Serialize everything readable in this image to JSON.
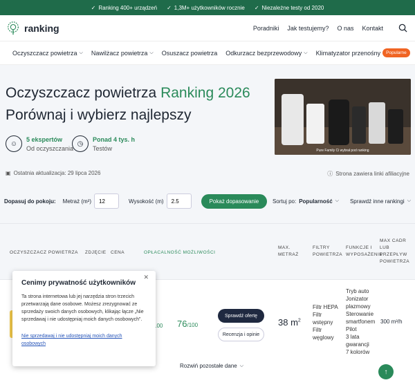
{
  "topbar": [
    "Ranking 400+ urządzeń",
    "1,3M+ użytkowników rocznie",
    "Niezależne testy od 2020"
  ],
  "logo": "ranking",
  "nav": [
    "Poradniki",
    "Jak testujemy?",
    "O nas",
    "Kontakt"
  ],
  "categories": [
    {
      "label": "Oczyszczacz powietrza",
      "chev": true
    },
    {
      "label": "Nawilżacz powietrza",
      "chev": true
    },
    {
      "label": "Osuszacz powietrza",
      "chev": false
    },
    {
      "label": "Odkurzacz bezprzewodowy",
      "chev": true
    },
    {
      "label": "Klimatyzator przenośny",
      "chev": false
    }
  ],
  "popular_badge": "Popularne",
  "hero": {
    "title_a": "Oczyszczacz powietrza",
    "title_b": "Ranking 2026",
    "subtitle": "Porównaj i wybierz najlepszy",
    "image_caption": "Pure Family Ci wybrał pod ranking",
    "expert_1": {
      "strong": "5 ekspertów",
      "sub": "Od oczyszczania"
    },
    "expert_2": {
      "strong": "Ponad 4 tys. h",
      "sub": "Testów"
    },
    "updated": "Ostatnia aktualizacja: 29 lipca 2026",
    "affiliate": "Strona zawiera linki afiliacyjne"
  },
  "fit": {
    "label": "Dopasuj do pokoju:",
    "area_label": "Metraż (m²)",
    "area_value": "12",
    "height_label": "Wysokość (m)",
    "height_value": "2.5",
    "button": "Pokaż dopasowanie",
    "sort_label": "Sortuj po:",
    "sort_value": "Popularność",
    "other": "Sprawdź inne rankingi"
  },
  "table": {
    "headers": {
      "product": "OCZYSZCZACZ POWIETRZA",
      "photo": "ZDJĘCIE",
      "price": "CENA",
      "value": "OPŁACALNOŚĆ MOŻLIWOŚCI",
      "area": "MAX. METRAŻ",
      "filters": "FILTRY POWIETRZA",
      "functions": "FUNKCJE I WYPOSAŻENIE",
      "cadr": "MAX CADR LUB PRZEPŁYW POWIETRZA"
    },
    "row": {
      "score_1": "100",
      "score_2": "76",
      "score_2_of": "/100",
      "offer": "Sprawdź ofertę",
      "review": "Recenzja i opinie",
      "area": "38 m",
      "area_sup": "2",
      "filters": [
        "Filtr HEPA",
        "Filtr wstępny",
        "Filtr węglowy"
      ],
      "functions": [
        "Tryb auto",
        "Jonizator plazmowy",
        "Sterowanie smartfonem",
        "Pilot",
        "3 lata gwarancji",
        "7 kolorów"
      ],
      "cadr": "300 m³/h"
    },
    "more": "Rozwiń pozostałe dane"
  },
  "cookie": {
    "title": "Cenimy prywatność użytkowników",
    "body": "Ta strona internetowa lub jej narzędzia stron trzecich przetwarzają dane osobowe. Możesz zrezygnować ze sprzedaży swoich danych osobowych, klikając łącze „Nie sprzedawaj i nie udostępniaj moich danych osobowych”.",
    "link": "Nie sprzedawaj i nie udostępniaj moich danych osobowych"
  },
  "colors": {
    "brand_green": "#2a8a5a",
    "topbar": "#1f6b4a",
    "badge": "#f06423"
  }
}
